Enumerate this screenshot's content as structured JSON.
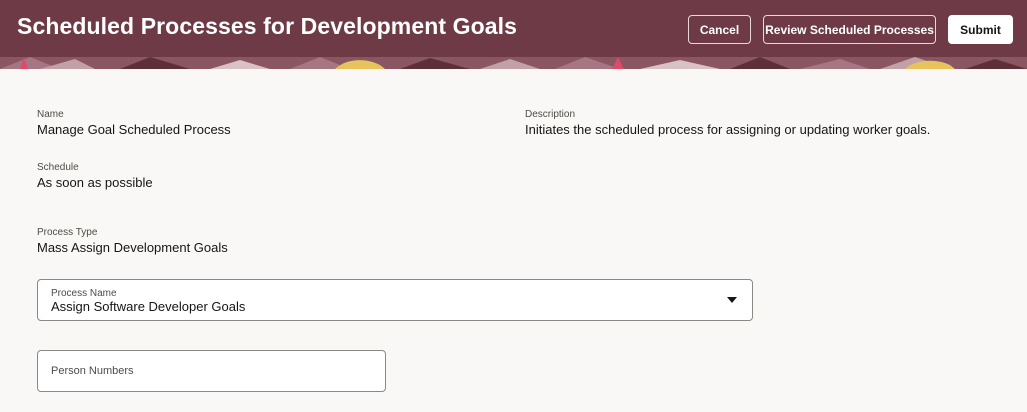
{
  "header": {
    "title": "Scheduled Processes for Development Goals",
    "background_color": "#6d3a46",
    "buttons": {
      "cancel": "Cancel",
      "review": "Review Scheduled Processes",
      "submit": "Submit"
    }
  },
  "details": {
    "name": {
      "label": "Name",
      "value": "Manage Goal Scheduled Process"
    },
    "description": {
      "label": "Description",
      "value": "Initiates the scheduled process for assigning or updating worker goals."
    },
    "schedule": {
      "label": "Schedule",
      "value": "As soon as possible"
    },
    "process_type": {
      "label": "Process Type",
      "value": "Mass Assign Development Goals"
    }
  },
  "process_name_select": {
    "label": "Process Name",
    "value": "Assign Software Developer Goals",
    "icon": "chevron-down-icon"
  },
  "person_numbers_input": {
    "label": "Person Numbers",
    "value": ""
  }
}
